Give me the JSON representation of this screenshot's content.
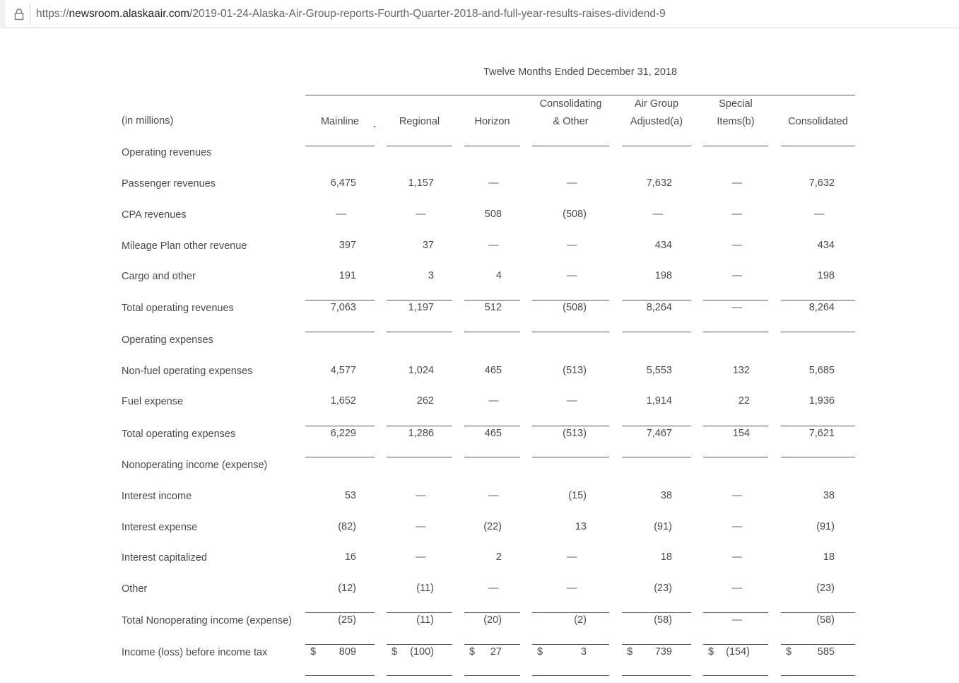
{
  "browser": {
    "url_scheme": "https://",
    "url_host": "newsroom.alaskaair.com",
    "url_path": "/2019-01-24-Alaska-Air-Group-reports-Fourth-Quarter-2018-and-full-year-results-raises-dividend-9"
  },
  "table": {
    "period": "Twelve Months Ended December 31, 2018",
    "unit_label": "(in millions)",
    "columns": [
      {
        "line1": "",
        "line2": "Mainline"
      },
      {
        "line1": "",
        "line2": "Regional"
      },
      {
        "line1": "",
        "line2": "Horizon"
      },
      {
        "line1": "Consolidating",
        "line2": "& Other"
      },
      {
        "line1": "Air Group",
        "line2": "Adjusted(a)"
      },
      {
        "line1": "Special",
        "line2": "Items(b)"
      },
      {
        "line1": "",
        "line2": "Consolidated"
      }
    ],
    "rows": [
      {
        "label": "Operating revenues",
        "values": []
      },
      {
        "label": "Passenger revenues",
        "values": [
          "6,475",
          "1,157",
          "—",
          "—",
          "7,632",
          "—",
          "7,632"
        ]
      },
      {
        "label": "CPA revenues",
        "values": [
          "—",
          "—",
          "508",
          "(508)",
          "—",
          "—",
          "—"
        ]
      },
      {
        "label": "Mileage Plan other revenue",
        "values": [
          "397",
          "37",
          "—",
          "—",
          "434",
          "—",
          "434"
        ]
      },
      {
        "label": "Cargo and other",
        "values": [
          "191",
          "3",
          "4",
          "—",
          "198",
          "—",
          "198"
        ]
      },
      {
        "label": "Total operating revenues",
        "values": [
          "7,063",
          "1,197",
          "512",
          "(508)",
          "8,264",
          "—",
          "8,264"
        ]
      },
      {
        "label": "Operating expenses",
        "values": []
      },
      {
        "label": "Non-fuel operating expenses",
        "values": [
          "4,577",
          "1,024",
          "465",
          "(513)",
          "5,553",
          "132",
          "5,685"
        ]
      },
      {
        "label": "Fuel expense",
        "values": [
          "1,652",
          "262",
          "—",
          "—",
          "1,914",
          "22",
          "1,936"
        ]
      },
      {
        "label": "Total operating expenses",
        "values": [
          "6,229",
          "1,286",
          "465",
          "(513)",
          "7,467",
          "154",
          "7,621"
        ]
      },
      {
        "label": "Nonoperating income (expense)",
        "values": []
      },
      {
        "label": "Interest income",
        "values": [
          "53",
          "—",
          "—",
          "(15)",
          "38",
          "—",
          "38"
        ]
      },
      {
        "label": "Interest expense",
        "values": [
          "(82)",
          "—",
          "(22)",
          "13",
          "(91)",
          "—",
          "(91)"
        ]
      },
      {
        "label": "Interest capitalized",
        "values": [
          "16",
          "—",
          "2",
          "—",
          "18",
          "—",
          "18"
        ]
      },
      {
        "label": "Other",
        "values": [
          "(12)",
          "(11)",
          "—",
          "—",
          "(23)",
          "—",
          "(23)"
        ]
      },
      {
        "label": "Total Nonoperating income (expense)",
        "values": [
          "(25)",
          "(11)",
          "(20)",
          "(2)",
          "(58)",
          "—",
          "(58)"
        ]
      },
      {
        "label": "Income (loss) before income tax",
        "currency": "$",
        "values": [
          "809",
          "(100)",
          "27",
          "3",
          "739",
          "(154)",
          "585"
        ]
      }
    ]
  }
}
